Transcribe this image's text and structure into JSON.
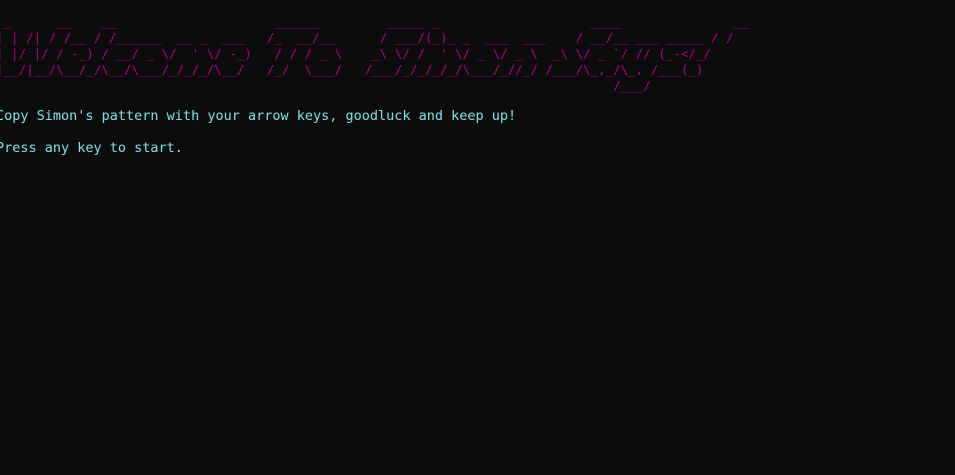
{
  "banner": {
    "ascii_art": " _      __    __                     ______         _____ _                    ____               __\n| | /| / /__ / /______  __ _  ___   /_  __/__      / ___/(_)_ _  ___  ___    / __/__ ___ _____ / /\n| |/ |/ / -_) / __/ _ \\/  ' \\/ -_)   / / / _ \\    _\\ \\/ /  ' \\/ _ \\/ _ \\  _\\ \\/ _ `/ // (_-</_/ \n|__/|__/\\__/_/\\__/\\___/_/_/_/\\__/   /_/  \\___/   /___/_/_/_/_/\\___/_//_/ /___/\\_,_/\\_, /___(_)  \n                                                                                  /___/         ",
    "color": "#b0008e"
  },
  "messages": {
    "instructions": "Copy Simon's pattern with your arrow keys, goodluck and keep up!",
    "start_prompt": "Press any key to start."
  },
  "colors": {
    "background": "#0c0c0c",
    "text": "#7fe3e5"
  }
}
